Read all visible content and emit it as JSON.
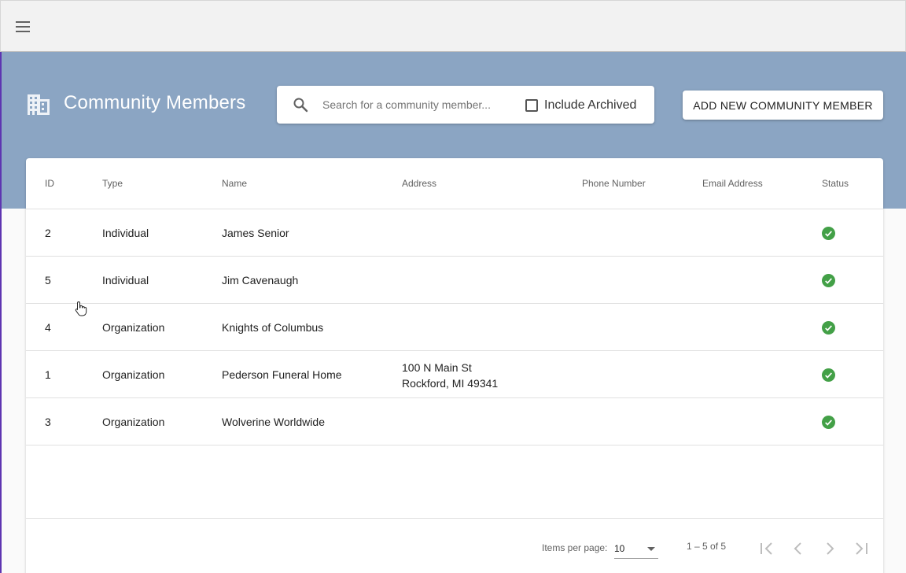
{
  "topbar": {
    "menu_icon": "menu-icon"
  },
  "header": {
    "icon": "building-icon",
    "title": "Community Members",
    "search_placeholder": "Search for a community member...",
    "search_value": "",
    "include_archived_label": "Include Archived",
    "include_archived_checked": false,
    "add_button_label": "ADD NEW COMMUNITY MEMBER"
  },
  "table": {
    "headers": {
      "id": "ID",
      "type": "Type",
      "name": "Name",
      "address": "Address",
      "phone": "Phone Number",
      "email": "Email Address",
      "status": "Status"
    },
    "rows": [
      {
        "id": "2",
        "type": "Individual",
        "name": "James Senior",
        "address_line1": "",
        "address_line2": "",
        "phone": "",
        "email": "",
        "status": "active-check-icon"
      },
      {
        "id": "5",
        "type": "Individual",
        "name": "Jim Cavenaugh",
        "address_line1": "",
        "address_line2": "",
        "phone": "",
        "email": "",
        "status": "active-check-icon"
      },
      {
        "id": "4",
        "type": "Organization",
        "name": "Knights of Columbus",
        "address_line1": "",
        "address_line2": "",
        "phone": "",
        "email": "",
        "status": "active-check-icon"
      },
      {
        "id": "1",
        "type": "Organization",
        "name": "Pederson Funeral Home",
        "address_line1": "100 N Main St",
        "address_line2": "Rockford, MI 49341",
        "phone": "",
        "email": "",
        "status": "active-check-icon"
      },
      {
        "id": "3",
        "type": "Organization",
        "name": "Wolverine Worldwide",
        "address_line1": "",
        "address_line2": "",
        "phone": "",
        "email": "",
        "status": "active-check-icon"
      }
    ]
  },
  "paginator": {
    "items_per_page_label": "Items per page:",
    "page_size": "10",
    "range_label": "1 – 5 of 5"
  },
  "colors": {
    "banner": "#8ba5c3",
    "status_active": "#43a047"
  }
}
